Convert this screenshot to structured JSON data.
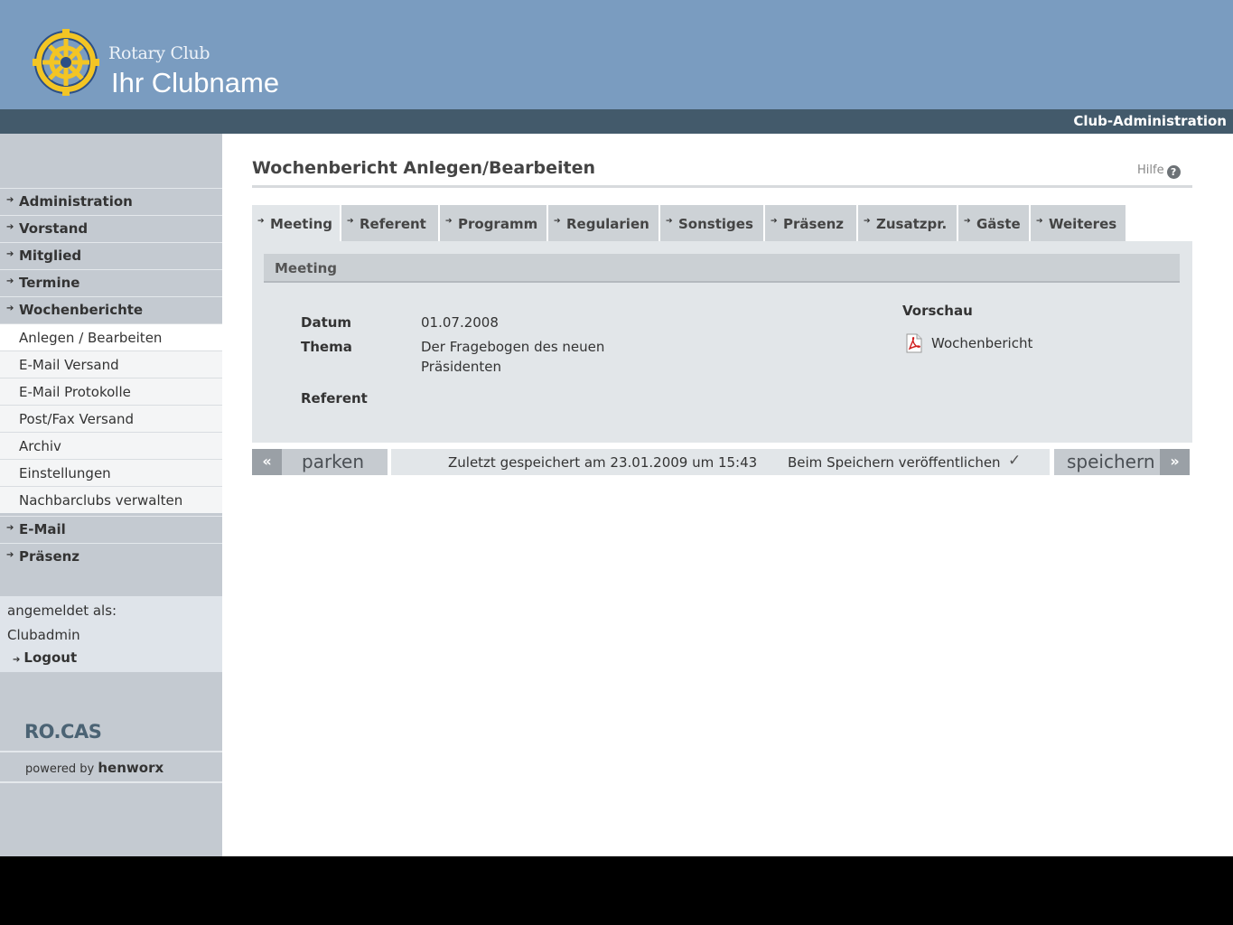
{
  "header": {
    "club_prefix": "Rotary Club",
    "club_name": "Ihr Clubname",
    "logo_icon": "rotary-wheel-icon",
    "section_title": "Club-Administration"
  },
  "sidebar": {
    "nav_top": [
      "Administration",
      "Vorstand",
      "Mitglied",
      "Termine",
      "Wochenberichte"
    ],
    "sub_items": [
      "Anlegen / Bearbeiten",
      "E-Mail Versand",
      "E-Mail Protokolle",
      "Post/Fax Versand",
      "Archiv",
      "Einstellungen",
      "Nachbarclubs verwalten"
    ],
    "active_sub": "Anlegen / Bearbeiten",
    "nav_bottom": [
      "E-Mail",
      "Präsenz"
    ],
    "login_label": "angemeldet als:",
    "login_user": "Clubadmin",
    "logout_label": "Logout",
    "brand": "RO.CAS",
    "powered_by": "powered by",
    "powered_company": "henworx"
  },
  "main": {
    "title": "Wochenbericht Anlegen/Bearbeiten",
    "help_label": "Hilfe",
    "help_icon": "question-mark-icon",
    "tabs": [
      "Meeting",
      "Referent",
      "Programm",
      "Regularien",
      "Sonstiges",
      "Präsenz",
      "Zusatzpr.",
      "Gäste",
      "Weiteres"
    ],
    "active_tab": "Meeting",
    "section_title": "Meeting",
    "fields": {
      "datum_label": "Datum",
      "datum_value": "01.07.2008",
      "thema_label": "Thema",
      "thema_value_line1": "Der Fragebogen des neuen",
      "thema_value_line2": "Präsidenten",
      "referent_label": "Referent",
      "referent_value": ""
    },
    "preview": {
      "title": "Vorschau",
      "link_label": "Wochenbericht",
      "icon": "pdf-icon"
    }
  },
  "actions": {
    "park_label": "parken",
    "park_icon": "double-chevron-left-icon",
    "last_saved": "Zuletzt gespeichert am 23.01.2009 um 15:43",
    "publish_label": "Beim Speichern veröffentlichen",
    "publish_checked": true,
    "save_label": "speichern",
    "save_icon": "double-chevron-right-icon"
  },
  "colors": {
    "header_blue": "#7a9cc0",
    "admin_bar": "#435a6b",
    "sidebar": "#c4cad1",
    "panel": "#e2e6e9"
  }
}
